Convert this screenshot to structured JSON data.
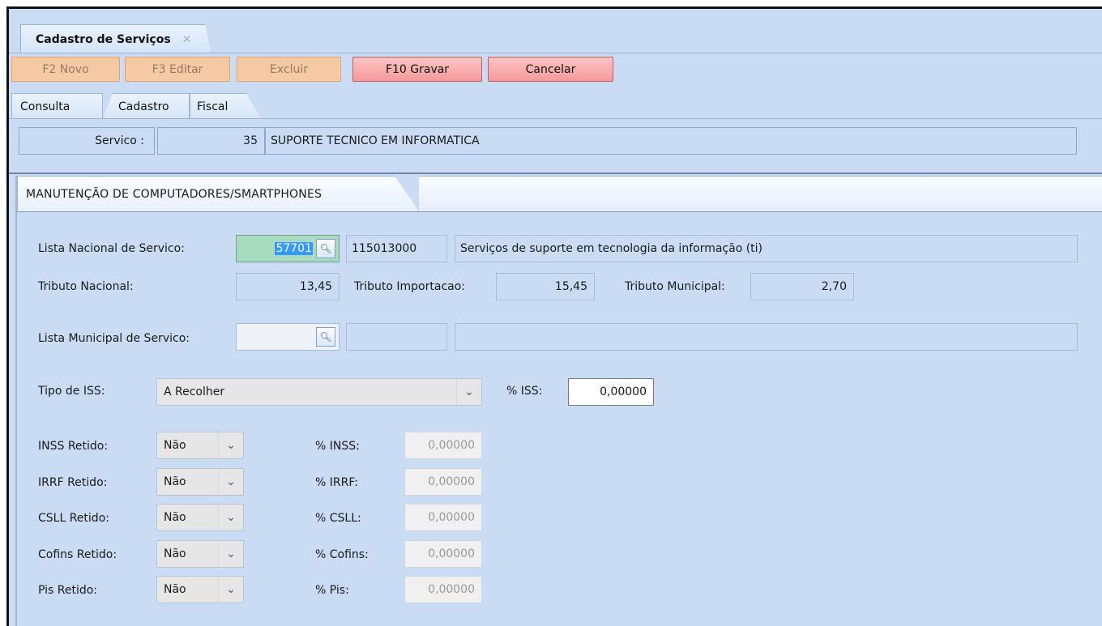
{
  "window": {
    "tab_title": "Cadastro de Serviços",
    "close_glyph": "✕"
  },
  "toolbar": {
    "new_label": "F2 Novo",
    "edit_label": "F3 Editar",
    "delete_label": "Excluir",
    "save_label": "F10 Gravar",
    "cancel_label": "Cancelar"
  },
  "tabs": [
    "Consulta",
    "Cadastro",
    "Fiscal"
  ],
  "service": {
    "label": "Servico :",
    "code": "35",
    "name": "SUPORTE TECNICO EM INFORMATICA"
  },
  "panel": {
    "title": "MANUTENÇÃO DE COMPUTADORES/SMARTPHONES"
  },
  "lista_nacional": {
    "label": "Lista Nacional de Servico:",
    "code": "57701",
    "number": "115013000",
    "description": "Serviços de suporte em tecnologia da informação (ti)"
  },
  "tributos": {
    "nacional_label": "Tributo Nacional:",
    "nacional_value": "13,45",
    "importacao_label": "Tributo Importacao:",
    "importacao_value": "15,45",
    "municipal_label": "Tributo Municipal:",
    "municipal_value": "2,70"
  },
  "lista_municipal": {
    "label": "Lista Municipal de Servico:"
  },
  "iss": {
    "tipo_label": "Tipo de ISS:",
    "tipo_value": "A Recolher",
    "pct_label": "% ISS:",
    "pct_value": "0,00000"
  },
  "retencoes": [
    {
      "label": "INSS Retido:",
      "value": "Não",
      "pct_label": "% INSS:",
      "pct_value": "0,00000"
    },
    {
      "label": "IRRF Retido:",
      "value": "Não",
      "pct_label": "% IRRF:",
      "pct_value": "0,00000"
    },
    {
      "label": "CSLL Retido:",
      "value": "Não",
      "pct_label": "% CSLL:",
      "pct_value": "0,00000"
    },
    {
      "label": "Cofins Retido:",
      "value": "Não",
      "pct_label": "% Cofins:",
      "pct_value": "0,00000"
    },
    {
      "label": "Pis Retido:",
      "value": "Não",
      "pct_label": "% Pis:",
      "pct_value": "0,00000"
    }
  ],
  "icons": {
    "lookup": "search-icon",
    "dropdown": "chevron-down-icon",
    "close": "close-icon"
  }
}
